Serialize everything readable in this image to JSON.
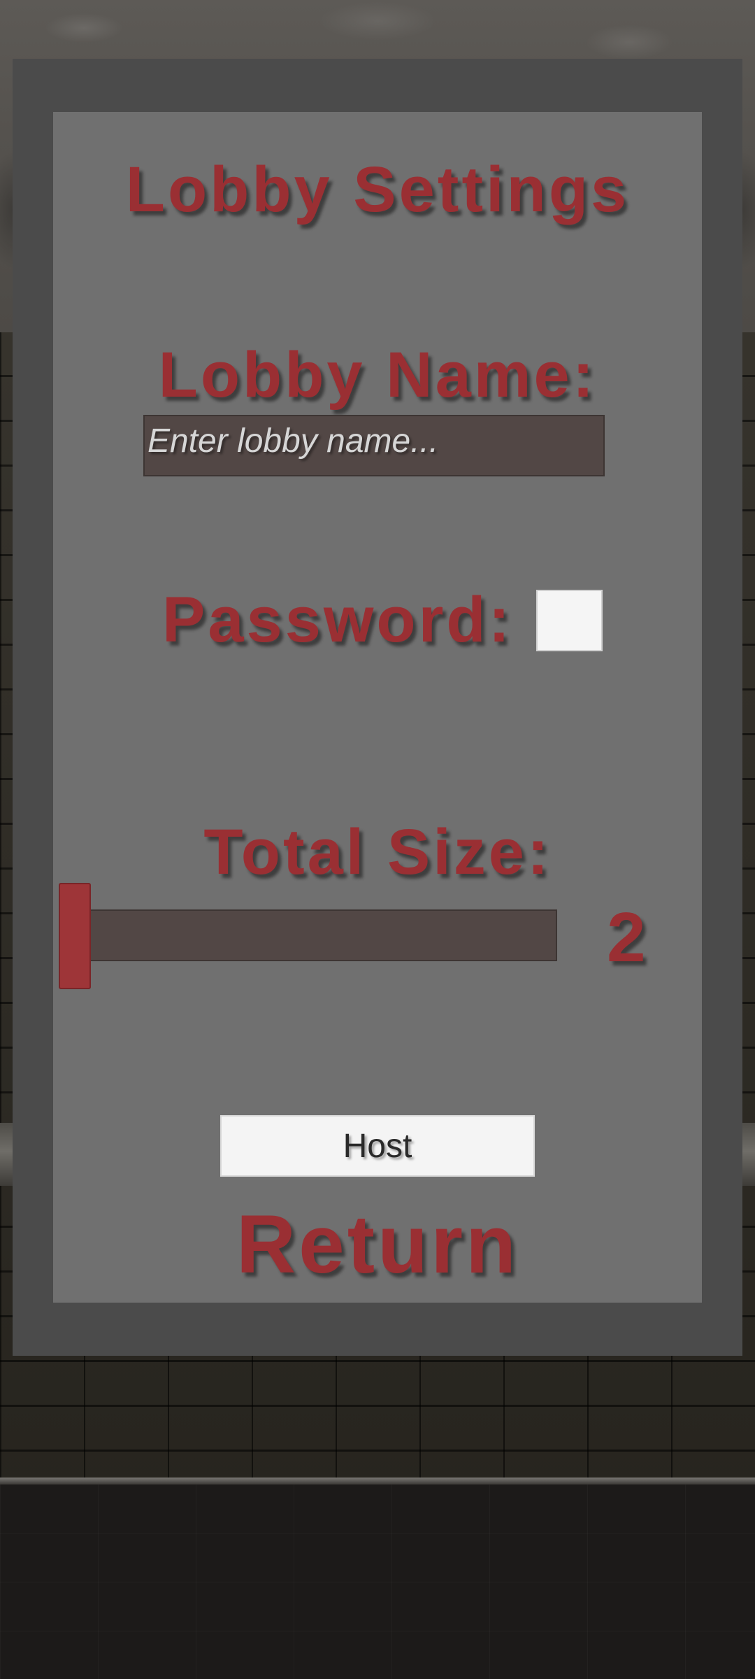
{
  "title": "Lobby Settings",
  "lobby_name": {
    "label": "Lobby Name:",
    "placeholder": "Enter lobby name...",
    "value": ""
  },
  "password": {
    "label": "Password:",
    "checked": false
  },
  "total_size": {
    "label": "Total Size:",
    "value": "2",
    "slider_fraction": 0.0
  },
  "buttons": {
    "host": "Host",
    "return": "Return"
  },
  "colors": {
    "accent_red": "#9a2f33",
    "panel_outer": "#4b4b4b",
    "panel_inner": "#707070",
    "input_bg": "#524745",
    "button_bg": "#f4f4f4"
  }
}
